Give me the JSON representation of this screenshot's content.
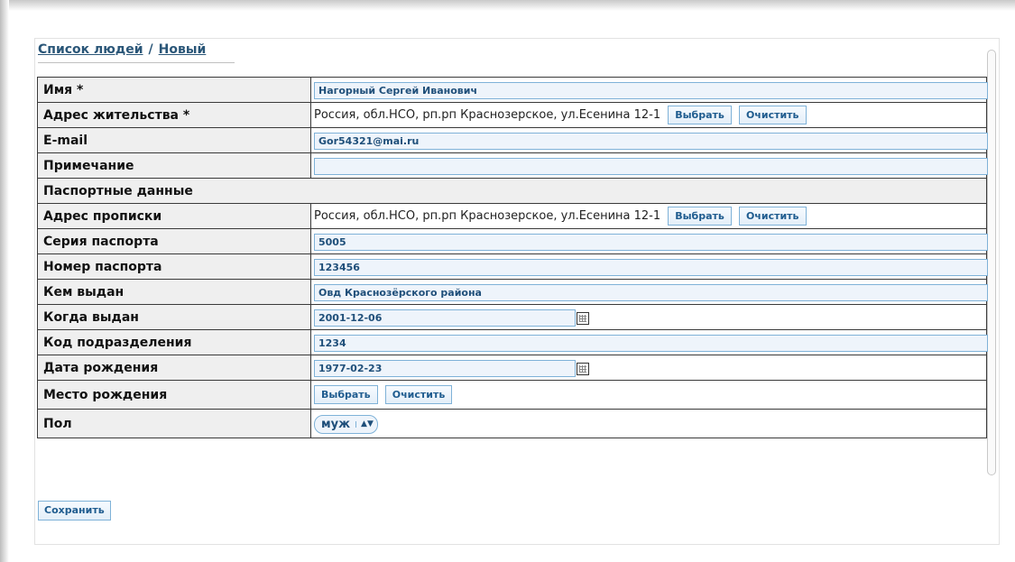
{
  "breadcrumb": {
    "list": "Список людей",
    "separator": "/",
    "current": "Новый"
  },
  "buttons": {
    "select": "Выбрать",
    "clear": "Очистить",
    "save": "Сохранить"
  },
  "fields": {
    "name": {
      "label": "Имя *",
      "value": "Нагорный Сергей Иванович"
    },
    "residence": {
      "label": "Адрес жительства *",
      "value": "Россия, обл.НСО, рп.рп Краснозерское, ул.Есенина 12-1"
    },
    "email": {
      "label": "E-mail",
      "value": "Gor54321@mai.ru"
    },
    "note": {
      "label": "Примечание",
      "value": ""
    },
    "passport_section": {
      "label": "Паспортные данные"
    },
    "registration": {
      "label": "Адрес прописки",
      "value": "Россия, обл.НСО, рп.рп Краснозерское, ул.Есенина 12-1"
    },
    "passport_series": {
      "label": "Серия паспорта",
      "value": "5005"
    },
    "passport_number": {
      "label": "Номер паспорта",
      "value": "123456"
    },
    "issued_by": {
      "label": "Кем выдан",
      "value": "Овд Краснозёрского района"
    },
    "issue_date": {
      "label": "Когда выдан",
      "value": "2001-12-06"
    },
    "division_code": {
      "label": "Код подразделения",
      "value": "1234"
    },
    "birth_date": {
      "label": "Дата рождения",
      "value": "1977-02-23"
    },
    "birth_place": {
      "label": "Место рождения"
    },
    "gender": {
      "label": "Пол",
      "value": "муж",
      "arrows": "▲▼"
    }
  },
  "icons": {
    "calendar": "calendar-icon"
  },
  "colors": {
    "link": "#2a5678",
    "input_border": "#7fb2d8",
    "input_bg": "#eef4fb",
    "label_bg": "#efefef"
  }
}
